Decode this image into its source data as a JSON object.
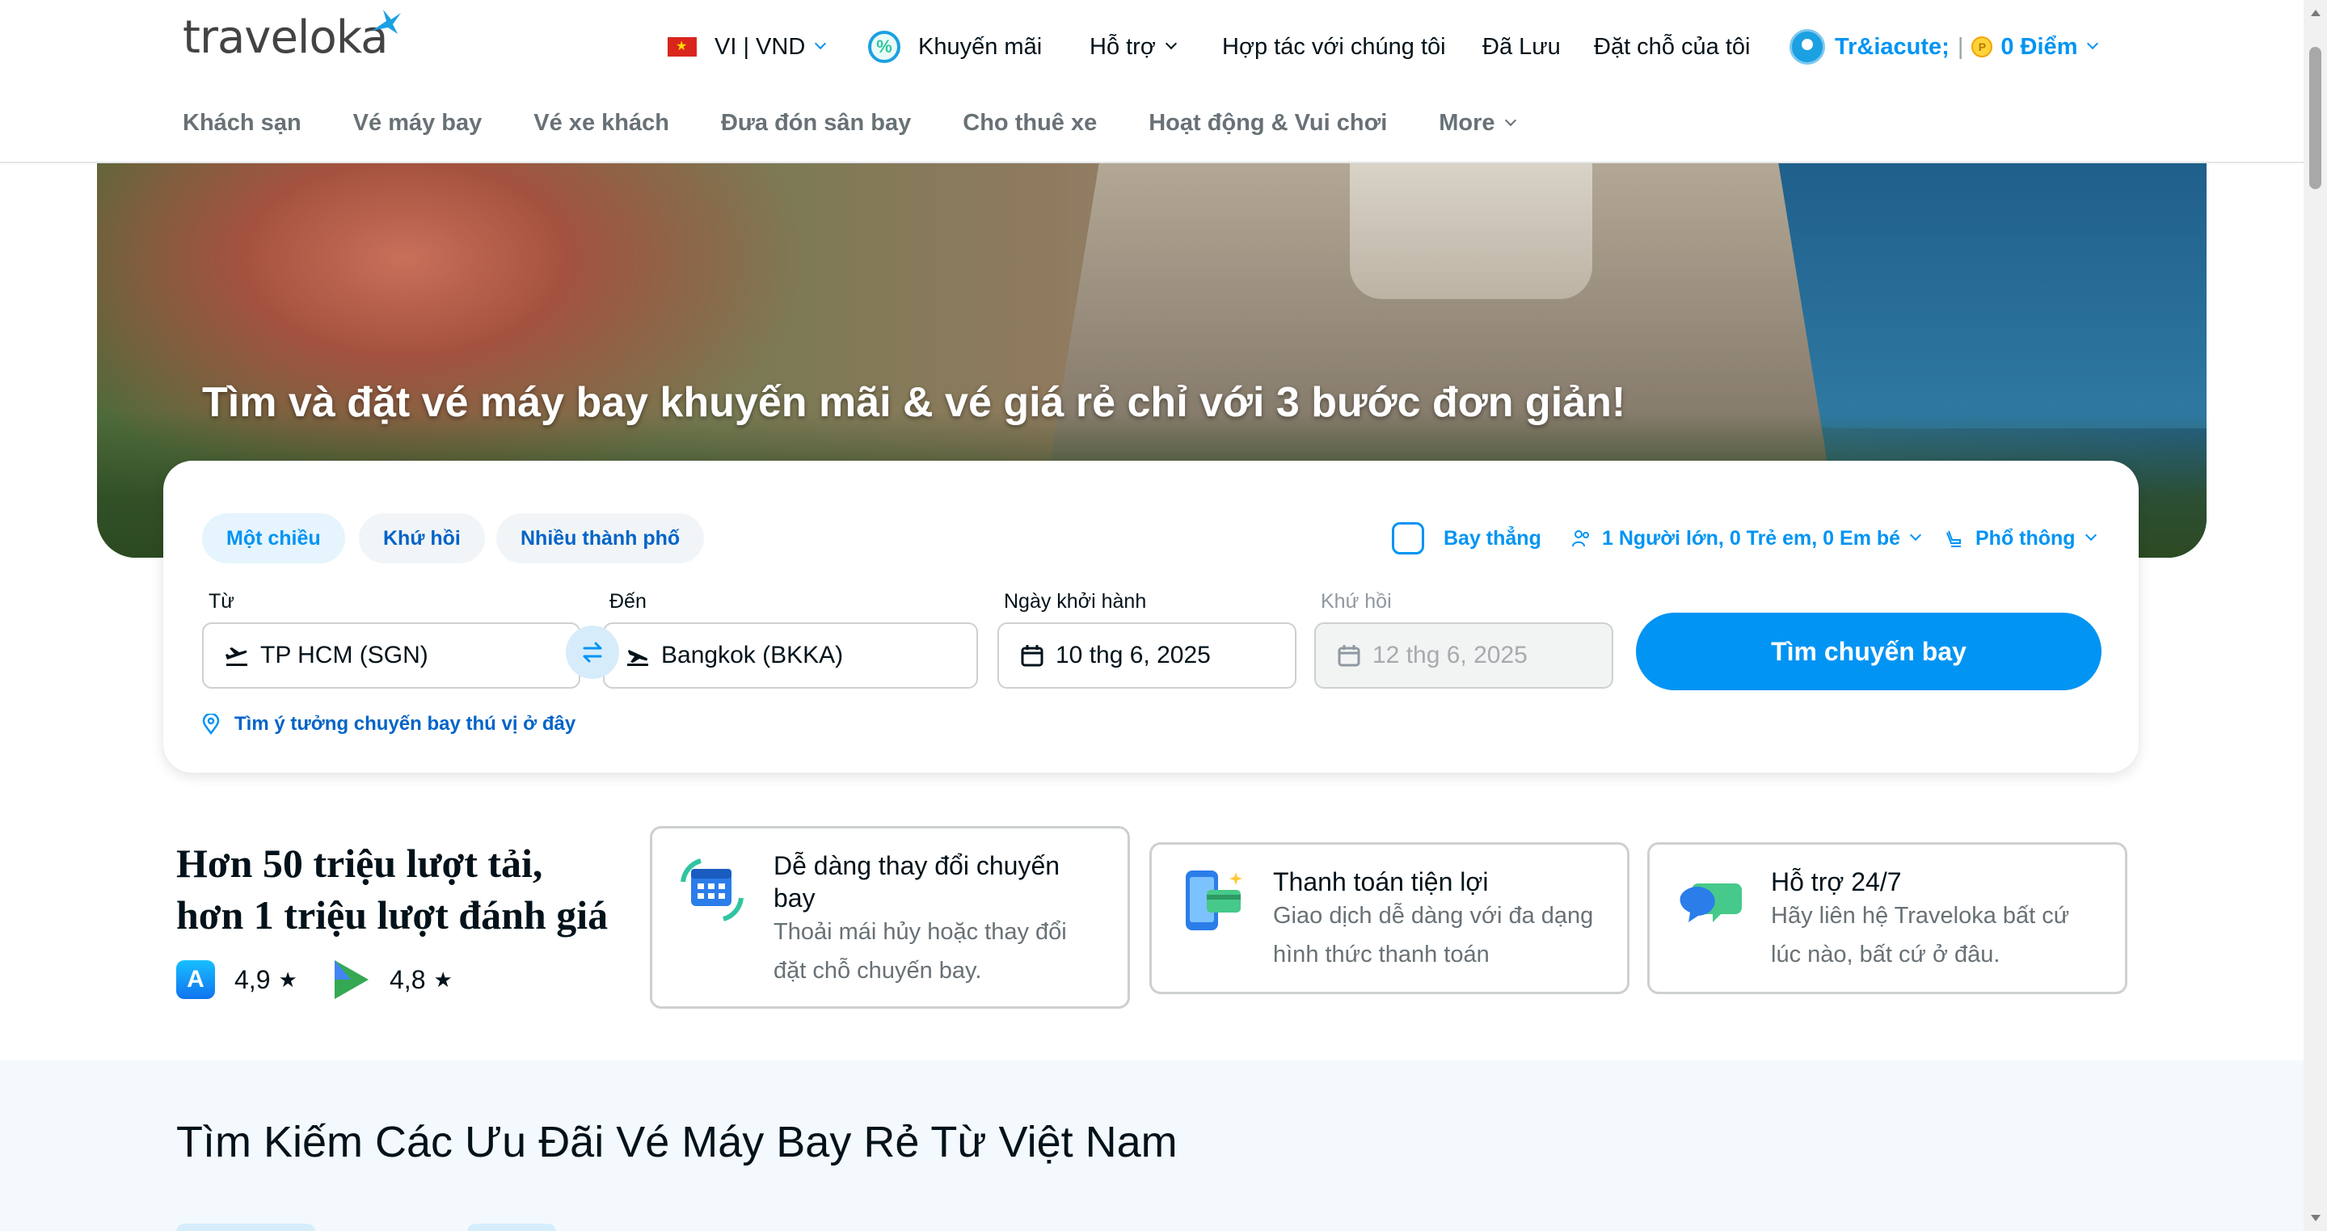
{
  "header": {
    "logo_text": "traveloka",
    "language_currency": "VI | VND",
    "promotions": "Khuyến mãi",
    "support": "Hỗ trợ",
    "partner": "Hợp tác với chúng tôi",
    "saved": "Đã Lưu",
    "my_bookings": "Đặt chỗ của tôi",
    "user_name": "Tr&iacute;",
    "separator": "|",
    "points": "0 Điểm"
  },
  "subnav": {
    "items": [
      "Khách sạn",
      "Vé máy bay",
      "Vé xe khách",
      "Đưa đón sân bay",
      "Cho thuê xe",
      "Hoạt động & Vui chơi",
      "More"
    ]
  },
  "hero": {
    "title": "Tìm và đặt vé máy bay khuyến mãi & vé giá rẻ chỉ với 3 bước đơn giản!"
  },
  "search": {
    "trip_types": [
      "Một chiều",
      "Khứ hồi",
      "Nhiều thành phố"
    ],
    "active_trip_type": "Một chiều",
    "direct_flight": "Bay thẳng",
    "passengers": "1 Người lớn, 0 Trẻ em, 0 Em bé",
    "cabin_class": "Phổ thông",
    "from_label": "Từ",
    "from_value": "TP HCM (SGN)",
    "to_label": "Đến",
    "to_value": "Bangkok (BKKA)",
    "depart_label": "Ngày khởi hành",
    "depart_value": "10 thg 6, 2025",
    "return_label": "Khứ hồi",
    "return_value": "12 thg 6, 2025",
    "search_button": "Tìm chuyến bay",
    "idea_link": "Tìm ý tưởng chuyến bay thú vị ở đây"
  },
  "stats": {
    "line1": "Hơn 50 triệu lượt tải,",
    "line2": "hơn 1 triệu lượt đánh giá",
    "appstore_rating": "4,9",
    "playstore_rating": "4,8"
  },
  "features": [
    {
      "title": "Dễ dàng thay đổi chuyến bay",
      "desc": "Thoải mái hủy hoặc thay đổi đặt chỗ chuyến bay.",
      "icon": "calendar-change-icon"
    },
    {
      "title": "Thanh toán tiện lợi",
      "desc": "Giao dịch dễ dàng với đa dạng hình thức thanh toán",
      "icon": "phone-payment-icon"
    },
    {
      "title": "Hỗ trợ 24/7",
      "desc": "Hãy liên hệ Traveloka bất cứ lúc nào, bất cứ ở đâu.",
      "icon": "chat-bubbles-icon"
    }
  ],
  "deals": {
    "title": "Tìm Kiếm Các Ưu Đãi Vé Máy Bay Rẻ Từ Việt Nam"
  },
  "colors": {
    "brand_blue": "#0194f3",
    "link_blue": "#0264c8",
    "text_dark": "#03121a",
    "text_muted": "#687176",
    "border": "#cdd0d1"
  }
}
